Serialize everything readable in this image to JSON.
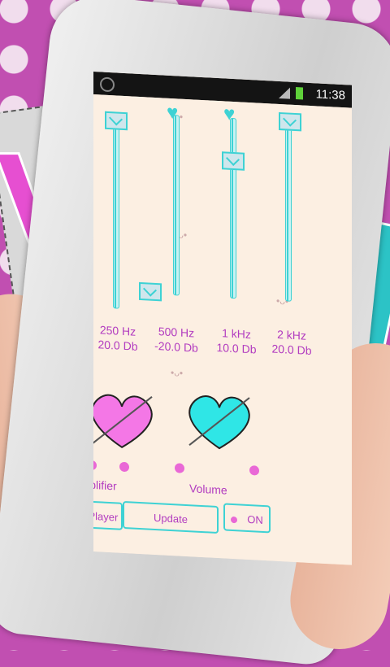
{
  "status_bar": {
    "time": "11:38"
  },
  "equalizer": {
    "bands": [
      {
        "freq": "250 Hz",
        "gain": "20.0 Db",
        "thumb": "envelope-icon",
        "level": 1.0
      },
      {
        "freq": "500 Hz",
        "gain": "-20.0 Db",
        "thumb": "envelope-icon",
        "level": 0.0
      },
      {
        "freq": "1 kHz",
        "gain": "10.0 Db",
        "thumb": "envelope-icon",
        "level": 0.75
      },
      {
        "freq": "2 kHz",
        "gain": "20.0 Db",
        "thumb": "envelope-icon",
        "level": 1.0
      }
    ]
  },
  "controls": {
    "preamplifier_label": "Preamplifier",
    "volume_label": "Volume"
  },
  "buttons": {
    "preset": "Preset: * FairPlayer",
    "update": "Update",
    "on": "ON"
  },
  "colors": {
    "accent": "#3ed2d4",
    "pink": "#e968d6",
    "text": "#b23cc0"
  }
}
